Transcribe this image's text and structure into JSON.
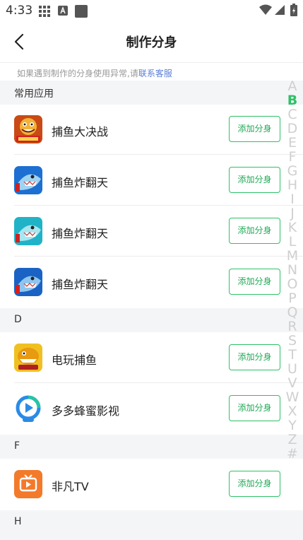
{
  "status_bar": {
    "time": "4:33"
  },
  "header": {
    "title": "制作分身"
  },
  "notice": {
    "text": "如果遇到制作的分身使用异常,请",
    "link": "联系客服"
  },
  "sections": [
    {
      "label": "常用应用"
    },
    {
      "label": "D"
    },
    {
      "label": "F"
    },
    {
      "label": "H"
    }
  ],
  "apps": [
    {
      "name": "捕鱼大决战",
      "button": "添加分身"
    },
    {
      "name": "捕鱼炸翻天",
      "button": "添加分身"
    },
    {
      "name": "捕鱼炸翻天",
      "button": "添加分身"
    },
    {
      "name": "捕鱼炸翻天",
      "button": "添加分身"
    },
    {
      "name": "电玩捕鱼",
      "button": "添加分身"
    },
    {
      "name": "多多蜂蜜影视",
      "button": "添加分身"
    },
    {
      "name": "非凡TV",
      "button": "添加分身"
    }
  ],
  "index_letters": [
    "A",
    "B",
    "C",
    "D",
    "E",
    "F",
    "G",
    "H",
    "I",
    "J",
    "K",
    "L",
    "M",
    "N",
    "O",
    "P",
    "Q",
    "R",
    "S",
    "T",
    "U",
    "V",
    "W",
    "X",
    "Y",
    "Z",
    "#"
  ],
  "index_active": "B",
  "colors": {
    "accent": "#2ec167",
    "link": "#5a7fd6",
    "section_bg": "#f4f5f7"
  }
}
